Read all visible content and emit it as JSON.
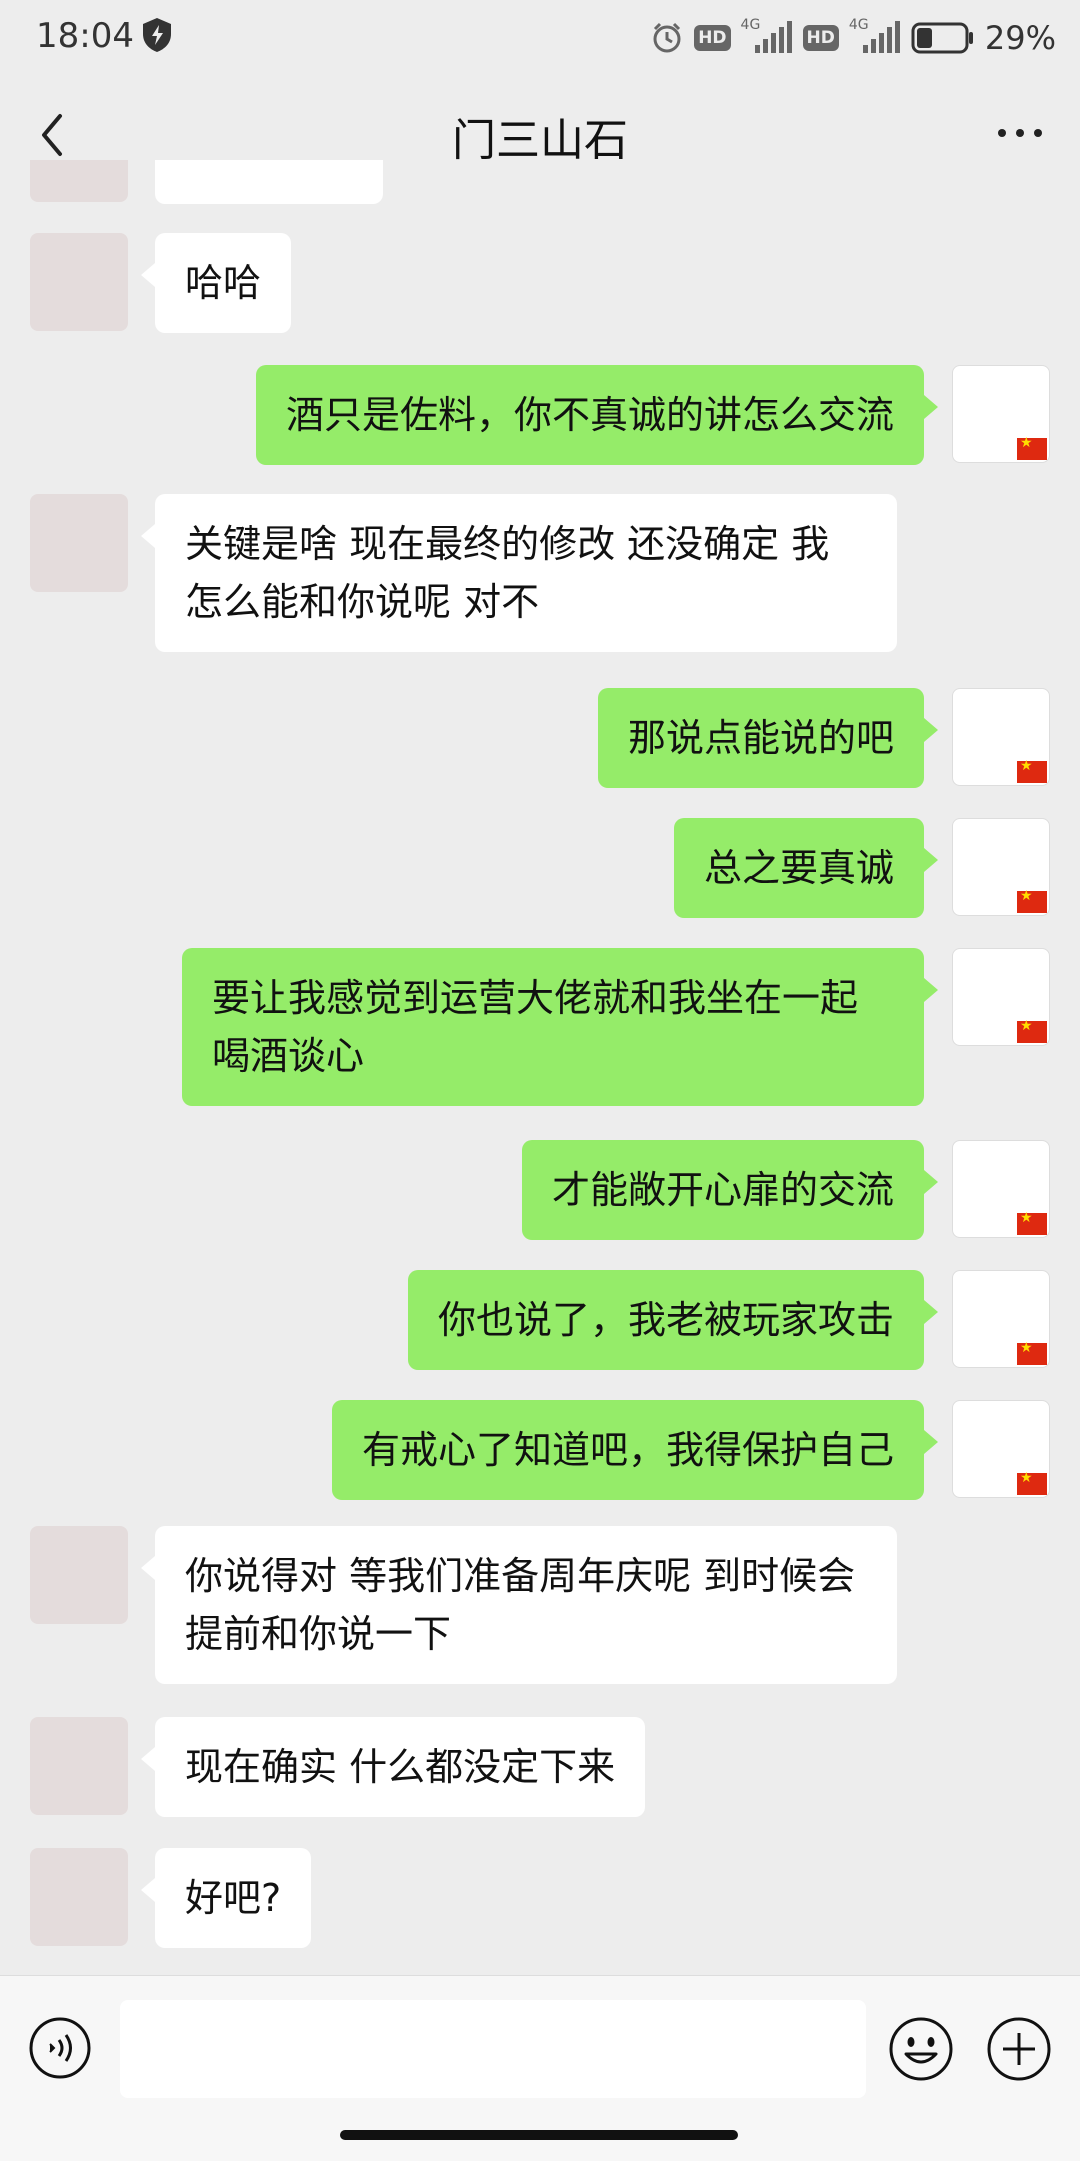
{
  "status_bar": {
    "time": "18:04",
    "network_1": "4G",
    "network_2": "4G",
    "hd_1": "HD",
    "hd_2": "HD",
    "battery": "29%",
    "icons": [
      "shield-icon",
      "alarm-icon",
      "hd-icon",
      "signal-icon",
      "hd-icon",
      "signal-icon",
      "battery-icon"
    ]
  },
  "header": {
    "title": "门三山石",
    "back_icon": "chevron-left-icon",
    "more_icon": "more-dots-icon"
  },
  "messages": [
    {
      "side": "left",
      "text": "哈哈"
    },
    {
      "side": "right",
      "text": "酒只是佐料，你不真诚的讲怎么交流"
    },
    {
      "side": "left",
      "text": "关键是啥 现在最终的修改 还没确定 我怎么能和你说呢 对不"
    },
    {
      "side": "right",
      "text": "那说点能说的吧"
    },
    {
      "side": "right",
      "text": "总之要真诚"
    },
    {
      "side": "right",
      "text": "要让我感觉到运营大佬就和我坐在一起喝酒谈心"
    },
    {
      "side": "right",
      "text": "才能敞开心扉的交流"
    },
    {
      "side": "right",
      "text": "你也说了，我老被玩家攻击"
    },
    {
      "side": "right",
      "text": "有戒心了知道吧，我得保护自己"
    },
    {
      "side": "left",
      "text": "你说得对 等我们准备周年庆呢 到时候会提前和你说一下"
    },
    {
      "side": "left",
      "text": "现在确实 什么都没定下来"
    },
    {
      "side": "left",
      "text": "好吧?"
    }
  ],
  "input_bar": {
    "voice_icon": "voice-icon",
    "emoji_icon": "emoji-icon",
    "plus_icon": "plus-icon",
    "input_value": ""
  }
}
